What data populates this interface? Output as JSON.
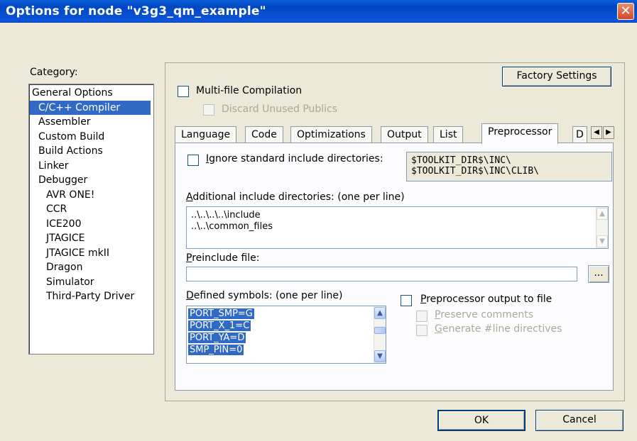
{
  "window": {
    "title": "Options for node \"v3g3_qm_example\"",
    "close_glyph": "✕"
  },
  "category": {
    "label": "Category:",
    "items": [
      {
        "label": "General Options",
        "indent": 0,
        "selected": false
      },
      {
        "label": "C/C++ Compiler",
        "indent": 1,
        "selected": true
      },
      {
        "label": "Assembler",
        "indent": 1,
        "selected": false
      },
      {
        "label": "Custom Build",
        "indent": 1,
        "selected": false
      },
      {
        "label": "Build Actions",
        "indent": 1,
        "selected": false
      },
      {
        "label": "Linker",
        "indent": 1,
        "selected": false
      },
      {
        "label": "Debugger",
        "indent": 1,
        "selected": false
      },
      {
        "label": "AVR ONE!",
        "indent": 2,
        "selected": false
      },
      {
        "label": "CCR",
        "indent": 2,
        "selected": false
      },
      {
        "label": "ICE200",
        "indent": 2,
        "selected": false
      },
      {
        "label": "JTAGICE",
        "indent": 2,
        "selected": false
      },
      {
        "label": "JTAGICE mkII",
        "indent": 2,
        "selected": false
      },
      {
        "label": "Dragon",
        "indent": 2,
        "selected": false
      },
      {
        "label": "Simulator",
        "indent": 2,
        "selected": false
      },
      {
        "label": "Third-Party Driver",
        "indent": 2,
        "selected": false
      }
    ]
  },
  "factory_settings_label": "Factory Settings",
  "multifile": {
    "label": "Multi-file Compilation",
    "checked": false,
    "discard_label": "Discard Unused Publics"
  },
  "tabs": {
    "items": [
      "Language",
      "Code",
      "Optimizations",
      "Output",
      "List",
      "Preprocessor",
      "D"
    ],
    "active": "Preprocessor",
    "scroll_left": "◀",
    "scroll_right": "▶"
  },
  "preprocessor": {
    "ignore_std_accel": "I",
    "ignore_std_rest": "gnore standard include directories:",
    "std_dirs": [
      "$TOOLKIT_DIR$\\INC\\",
      "$TOOLKIT_DIR$\\INC\\CLIB\\"
    ],
    "additional_accel": "A",
    "additional_rest": "dditional include directories: (one per line)",
    "additional_dirs": [
      "..\\..\\..\\..\\include",
      "..\\..\\common_files"
    ],
    "preinclude_accel": "P",
    "preinclude_rest": "reinclude file:",
    "preinclude_value": "",
    "browse_label": "...",
    "defined_accel": "D",
    "defined_rest": "efined symbols: (one per line)",
    "defined_symbols": [
      "PORT_SMP=G",
      "PORT_X_1=C",
      "PORT_YA=D",
      "SMP_PIN=0"
    ],
    "output_to_file_accel": "P",
    "output_to_file_rest": "reprocessor output to file",
    "preserve_accel": "P",
    "preserve_rest": "reserve comments",
    "generate_accel": "G",
    "generate_rest": "enerate #line directives"
  },
  "buttons": {
    "ok": "OK",
    "cancel": "Cancel"
  }
}
